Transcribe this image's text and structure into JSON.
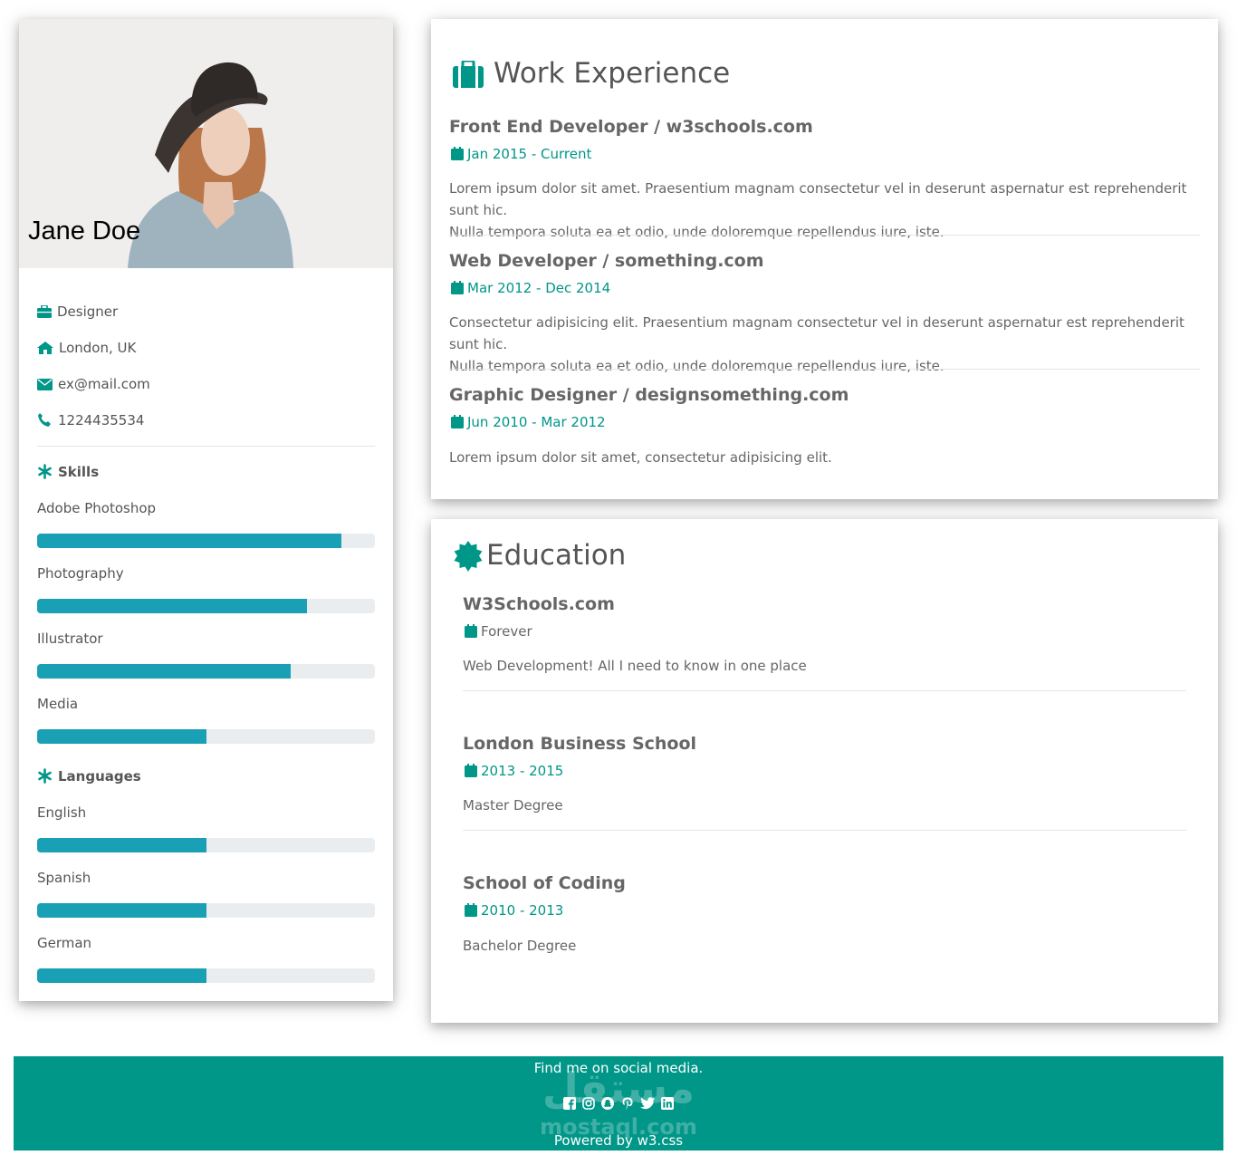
{
  "profile": {
    "name": "Jane Doe",
    "job": "Designer",
    "location": "London, UK",
    "email": "ex@mail.com",
    "phone": "1224435534"
  },
  "skills": {
    "heading": "Skills",
    "items": [
      {
        "label": "Adobe Photoshop",
        "level": 0.9
      },
      {
        "label": "Photography",
        "level": 0.8
      },
      {
        "label": "Illustrator",
        "level": 0.75
      },
      {
        "label": "Media",
        "level": 0.5
      }
    ]
  },
  "languages": {
    "heading": "Languages",
    "items": [
      {
        "label": "English",
        "level": 0.5
      },
      {
        "label": "Spanish",
        "level": 0.5
      },
      {
        "label": "German",
        "level": 0.5
      }
    ]
  },
  "work": {
    "title": "Work Experience",
    "jobs": [
      {
        "title": "Front End Developer / w3schools.com",
        "date": "Jan 2015 - Current",
        "desc_lines": [
          "Lorem ipsum dolor sit amet. Praesentium magnam consectetur vel in deserunt aspernatur est reprehenderit sunt hic.",
          "Nulla tempora soluta ea et odio, unde doloremque repellendus iure, iste."
        ]
      },
      {
        "title": "Web Developer / something.com",
        "date": "Mar 2012 - Dec 2014",
        "desc_lines": [
          "Consectetur adipisicing elit. Praesentium magnam consectetur vel in deserunt aspernatur est reprehenderit sunt hic.",
          "Nulla tempora soluta ea et odio, unde doloremque repellendus iure, iste."
        ]
      },
      {
        "title": "Graphic Designer / designsomething.com",
        "date": "Jun 2010 - Mar 2012",
        "desc_lines": [
          "Lorem ipsum dolor sit amet, consectetur adipisicing elit."
        ]
      }
    ]
  },
  "education": {
    "title": "Education",
    "items": [
      {
        "title": "W3Schools.com",
        "date": "Forever",
        "desc": "Web Development! All I need to know in one place"
      },
      {
        "title": "London Business School",
        "date": "2013 - 2015",
        "desc": "Master Degree"
      },
      {
        "title": "School of Coding",
        "date": "2010 - 2013",
        "desc": "Bachelor Degree"
      }
    ]
  },
  "footer": {
    "find": "Find me on social media.",
    "social": [
      "facebook-icon",
      "instagram-icon",
      "snapchat-icon",
      "pinterest-icon",
      "twitter-icon",
      "linkedin-icon"
    ],
    "powered": "Powered by w3.css",
    "watermark_arabic": "مستقل",
    "watermark_latin": "mostaql.com"
  },
  "colors": {
    "accent": "#009688",
    "bar_fill": "#1aa0b5",
    "bar_track": "#eaedf0",
    "footer_bg": "#009688"
  }
}
